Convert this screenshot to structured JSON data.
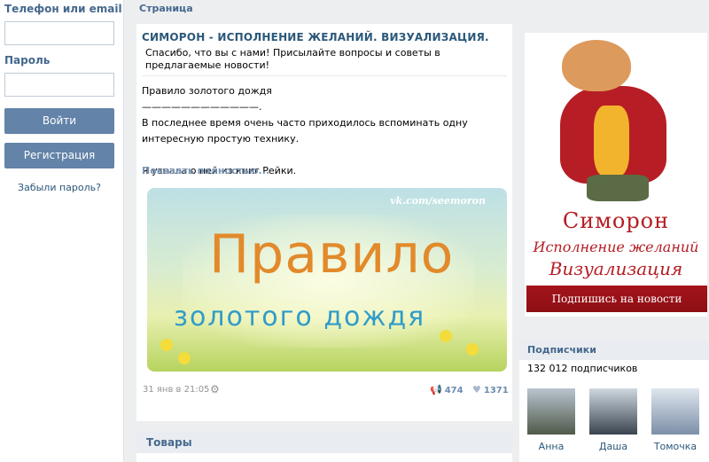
{
  "login": {
    "phone_label": "Телефон или email",
    "password_label": "Пароль",
    "login_button": "Войти",
    "register_button": "Регистрация",
    "forgot_link": "Забыли пароль?"
  },
  "page": {
    "top_label": "Страница"
  },
  "post": {
    "title": "СИМОРОН - ИСПОЛНЕНИЕ ЖЕЛАНИЙ. ВИЗУАЛИЗАЦИЯ.",
    "description": "Спасибо, что вы с нами! Присылайте вопросы и советы в предлагаемые новости!",
    "body": "Правило золотого дождя\n————————————.\nВ последнее время очень часто приходилось вспоминать одну интересную простую технику.\n\nЯ узнала о ней из книг Рейки.",
    "show_more": "Показать полностью...",
    "image": {
      "url_text": "vk.com/seemoron",
      "line1": "Правило",
      "line2": "золотого дождя"
    },
    "date": "31 янв в 21:05",
    "reposts": "474",
    "likes": "1371"
  },
  "goods": {
    "title": "Товары"
  },
  "promo": {
    "name": "Симорон",
    "line2": "Исполнение желаний",
    "line3": "Визуализация",
    "ribbon": "Подпишись на новости"
  },
  "subscribers": {
    "title": "Подписчики",
    "count": "132 012 подписчиков",
    "people": [
      {
        "name": "Анна"
      },
      {
        "name": "Даша"
      },
      {
        "name": "Томочка"
      }
    ]
  },
  "colors": {
    "accent": "#45688e",
    "button": "#6383a8",
    "link": "#2b587a"
  }
}
